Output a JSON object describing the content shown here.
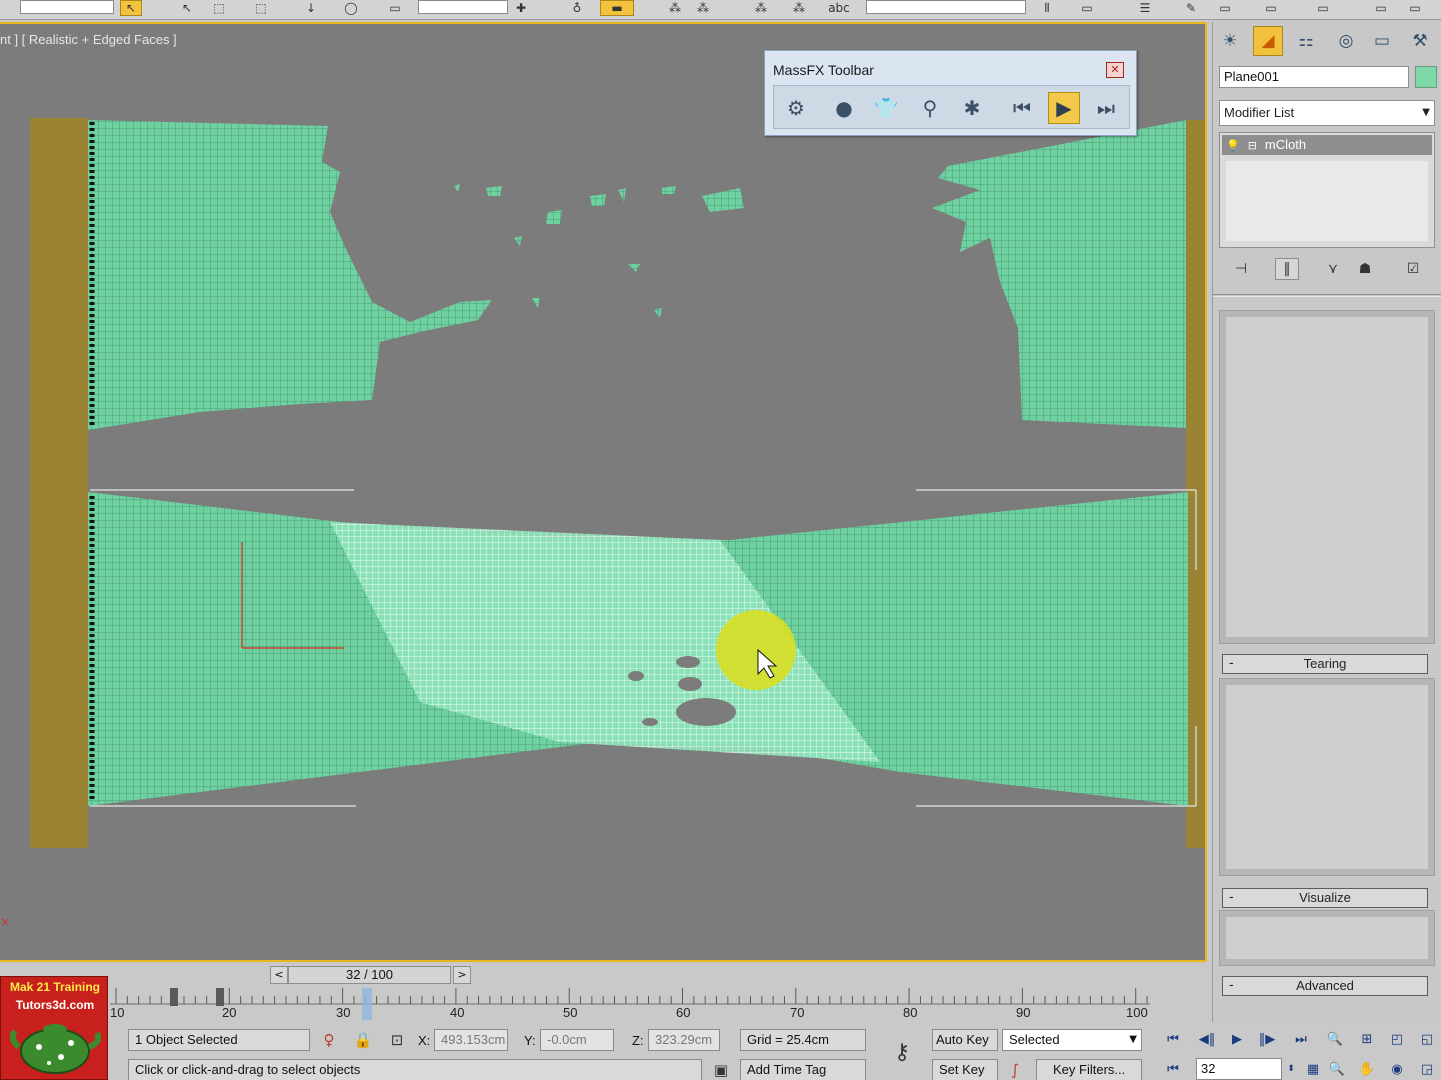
{
  "viewport": {
    "label": "nt ] [ Realistic + Edged Faces ]"
  },
  "massfx": {
    "title": "MassFX Toolbar",
    "close_glyph": "✕",
    "buttons": [
      {
        "name": "world-parameters-icon",
        "glyph": "⚙"
      },
      {
        "name": "rigid-body-icon",
        "glyph": "●"
      },
      {
        "name": "mcloth-icon",
        "glyph": "👕"
      },
      {
        "name": "constraint-icon",
        "glyph": "⚲"
      },
      {
        "name": "ragdoll-icon",
        "glyph": "✱"
      },
      {
        "name": "reset-simulation-icon",
        "glyph": "⏮"
      },
      {
        "name": "play-simulation-icon",
        "glyph": "▶"
      },
      {
        "name": "step-simulation-icon",
        "glyph": "⏭"
      }
    ]
  },
  "command_panel": {
    "tabs": [
      {
        "name": "create-tab-icon",
        "glyph": "☀"
      },
      {
        "name": "modify-tab-icon",
        "glyph": "◢"
      },
      {
        "name": "hierarchy-tab-icon",
        "glyph": "⚏"
      },
      {
        "name": "motion-tab-icon",
        "glyph": "◎"
      },
      {
        "name": "display-tab-icon",
        "glyph": "▭"
      },
      {
        "name": "utilities-tab-icon",
        "glyph": "⚒"
      }
    ],
    "object_name": "Plane001",
    "modifier_list": "Modifier List",
    "stack_item": "mCloth",
    "stack_tools": [
      {
        "name": "pin-stack-icon",
        "glyph": "⊣"
      },
      {
        "name": "show-end-result-icon",
        "glyph": "‖"
      },
      {
        "name": "make-unique-icon",
        "glyph": "⋎"
      },
      {
        "name": "remove-modifier-icon",
        "glyph": "☗"
      },
      {
        "name": "configure-sets-icon",
        "glyph": "☑"
      }
    ],
    "rollouts": [
      "Tearing",
      "Visualize",
      "Advanced"
    ],
    "colors": {
      "object": "#7fd8a7",
      "active_tab": "#f2c23c"
    }
  },
  "logo": {
    "line1": "Mak 21 Training",
    "line2": "Tutors3d.com"
  },
  "time_slider": {
    "prev": "<",
    "next": ">",
    "label": "32 / 100"
  },
  "trackbar": {
    "ticks": [
      "10",
      "20",
      "30",
      "40",
      "50",
      "60",
      "70",
      "80",
      "90",
      "100"
    ]
  },
  "status": {
    "selection": "1 Object Selected",
    "prompt": "Click or click-and-drag to select objects",
    "x_label": "X:",
    "x_value": "493.153cm",
    "y_label": "Y:",
    "y_value": "-0.0cm",
    "z_label": "Z:",
    "z_value": "323.29cm",
    "grid": "Grid = 25.4cm",
    "add_time_tag": "Add Time Tag",
    "auto_key": "Auto Key",
    "set_key": "Set Key",
    "selected": "Selected",
    "key_filters": "Key Filters..."
  },
  "anim": {
    "frame": "32"
  }
}
